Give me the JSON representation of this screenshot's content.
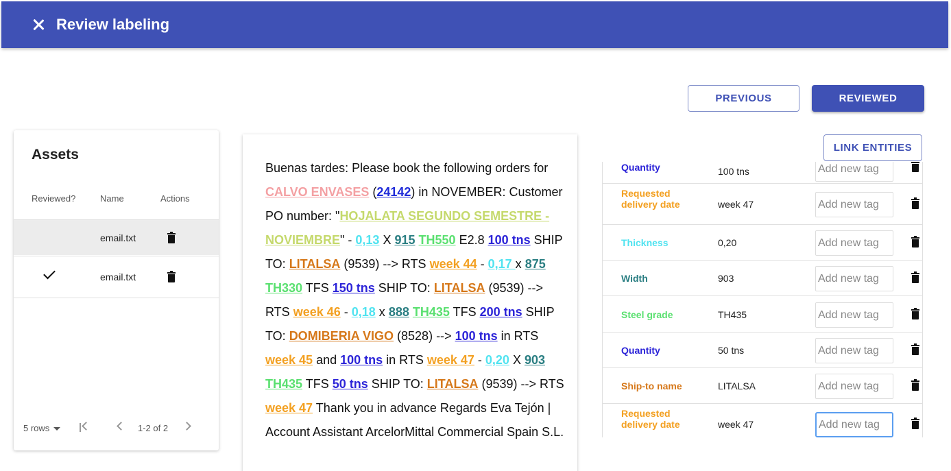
{
  "appbar": {
    "title": "Review labeling"
  },
  "buttons": {
    "previous": "PREVIOUS",
    "reviewed": "REVIEWED",
    "link_entities": "LINK ENTITIES"
  },
  "assets": {
    "title": "Assets",
    "columns": [
      "Reviewed?",
      "Name",
      "Actions"
    ],
    "rows": [
      {
        "name": "email.txt",
        "reviewed": false
      },
      {
        "name": "email.txt",
        "reviewed": true
      }
    ],
    "pager": {
      "rows_per_page": "5 rows",
      "range": "1-2 of 2"
    }
  },
  "document": {
    "segments": [
      {
        "text": "Buenas tardes: Please book the following orders for "
      },
      {
        "text": "CALVO ENVASES",
        "entity": "company"
      },
      {
        "text": " ("
      },
      {
        "text": "24142",
        "entity": "po"
      },
      {
        "text": ") in NOVEMBER: Customer PO number: \""
      },
      {
        "text": "HOJALATA SEGUNDO SEMESTRE - NOVIEMBRE",
        "entity": "ref"
      },
      {
        "text": "\" - "
      },
      {
        "text": "0,13",
        "entity": "thick"
      },
      {
        "text": " X "
      },
      {
        "text": "915",
        "entity": "width"
      },
      {
        "text": " "
      },
      {
        "text": "TH550",
        "entity": "grade"
      },
      {
        "text": " E2.8 "
      },
      {
        "text": "100 tns",
        "entity": "qty"
      },
      {
        "text": " SHIP TO: "
      },
      {
        "text": "LITALSA",
        "entity": "ship"
      },
      {
        "text": " (9539) --> RTS "
      },
      {
        "text": "week 44",
        "entity": "week"
      },
      {
        "text": " - "
      },
      {
        "text": "0,17 ",
        "entity": "thick"
      },
      {
        "text": "x "
      },
      {
        "text": "875",
        "entity": "width"
      },
      {
        "text": " "
      },
      {
        "text": "TH330",
        "entity": "grade"
      },
      {
        "text": " TFS "
      },
      {
        "text": "150 tns",
        "entity": "qty"
      },
      {
        "text": " SHIP TO: "
      },
      {
        "text": "LITALSA",
        "entity": "ship"
      },
      {
        "text": " (9539) --> RTS "
      },
      {
        "text": "week 46",
        "entity": "week"
      },
      {
        "text": " - "
      },
      {
        "text": "0,18",
        "entity": "thick"
      },
      {
        "text": " x "
      },
      {
        "text": "888",
        "entity": "width"
      },
      {
        "text": " "
      },
      {
        "text": "TH435",
        "entity": "grade"
      },
      {
        "text": " TFS "
      },
      {
        "text": "200 tns",
        "entity": "qty"
      },
      {
        "text": " SHIP TO: "
      },
      {
        "text": "DOMIBERIA VIGO",
        "entity": "ship"
      },
      {
        "text": " (8528) --> "
      },
      {
        "text": "100 tns",
        "entity": "qty"
      },
      {
        "text": " in RTS "
      },
      {
        "text": "week 45",
        "entity": "week"
      },
      {
        "text": " and "
      },
      {
        "text": "100 tns",
        "entity": "qty"
      },
      {
        "text": " in RTS "
      },
      {
        "text": "week 47",
        "entity": "week"
      },
      {
        "text": " - "
      },
      {
        "text": "0,20",
        "entity": "thick"
      },
      {
        "text": " X "
      },
      {
        "text": "903",
        "entity": "width"
      },
      {
        "text": " "
      },
      {
        "text": "TH435",
        "entity": "grade"
      },
      {
        "text": " TFS "
      },
      {
        "text": "50 tns",
        "entity": "qty"
      },
      {
        "text": " SHIP TO: "
      },
      {
        "text": "LITALSA",
        "entity": "ship"
      },
      {
        "text": " (9539) --> RTS "
      },
      {
        "text": "week 47",
        "entity": "week"
      },
      {
        "text": " Thank you in advance Regards Eva Tejón | Account Assistant ArcelorMittal Commercial Spain S.L."
      }
    ]
  },
  "entity_colors": {
    "company": "#f4a0a3",
    "po": "#1f2bd9",
    "ref": "#c5d96c",
    "thick": "#50e3f0",
    "width": "#2a7e82",
    "grade": "#5ae070",
    "qty": "#2c24d8",
    "ship": "#d6781a",
    "week": "#f3a021"
  },
  "entities": [
    {
      "label": "Quantity",
      "value": "100 tns",
      "color": "#2c24d8",
      "placeholder": "Add new tag"
    },
    {
      "label": "Requested delivery date",
      "value": "week 47",
      "color": "#f3a021",
      "placeholder": "Add new tag"
    },
    {
      "label": "Thickness",
      "value": "0,20",
      "color": "#50e3f0",
      "placeholder": "Add new tag"
    },
    {
      "label": "Width",
      "value": "903",
      "color": "#2a7e82",
      "placeholder": "Add new tag"
    },
    {
      "label": "Steel grade",
      "value": "TH435",
      "color": "#5ae070",
      "placeholder": "Add new tag"
    },
    {
      "label": "Quantity",
      "value": "50 tns",
      "color": "#2c24d8",
      "placeholder": "Add new tag"
    },
    {
      "label": "Ship-to name",
      "value": "LITALSA",
      "color": "#d6781a",
      "placeholder": "Add new tag"
    },
    {
      "label": "Requested delivery date",
      "value": "week 47",
      "color": "#f3a021",
      "placeholder": "Add new tag"
    }
  ]
}
